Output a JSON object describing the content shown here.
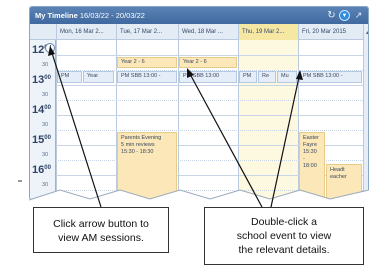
{
  "window": {
    "title_bold": "My Timeline",
    "title_range": "16/03/22 - 20/03/22",
    "icons": [
      "refresh-icon",
      "dropdown-icon",
      "expand-icon"
    ]
  },
  "days": [
    {
      "label": "Mon, 16 Mar 2..."
    },
    {
      "label": "Tue, 17 Mar 2..."
    },
    {
      "label": "Wed, 18 Mar ..."
    },
    {
      "label": "Thu, 19 Mar 2..."
    },
    {
      "label": "Fri, 20 Mar 2015"
    }
  ],
  "times": {
    "h12": "12",
    "h13": "13",
    "h14": "14",
    "h15": "15",
    "h16": "16",
    "sup": "00",
    "half": "30"
  },
  "events": {
    "mon_pm": "PM",
    "mon_year": "Year",
    "tue_year": "Year 2 - 6",
    "tue_sbb": "PM SBB  13:00 -",
    "wed_year": "Year 2 - 6",
    "wed_sbb": "PM SBB  13:00",
    "thu_pm": "PM",
    "thu_re": "Re",
    "thu_mu": "Mu",
    "fri_sbb": "PM SBB  13:00 -",
    "parents_title": "Parents Evening",
    "parents_line2": "5 min reviews",
    "parents_time": "15:30 - 18:30",
    "easter_title": "Easter",
    "easter_line2": "Fayre",
    "easter_time": "15:30",
    "easter_dash": "-",
    "easter_end": "18:00",
    "headt_line1": "Headt",
    "headt_line2": "eacher"
  },
  "callouts": {
    "left_line1": "Click arrow button to",
    "left_line2": "view AM sessions.",
    "right_line1": "Double-click a",
    "right_line2": "school event to view",
    "right_line3": "the relevant details."
  },
  "colors": {
    "titlebar": "#4a74aa",
    "event_fill": "#fbe7b7",
    "today_fill": "#f6e7a3"
  }
}
